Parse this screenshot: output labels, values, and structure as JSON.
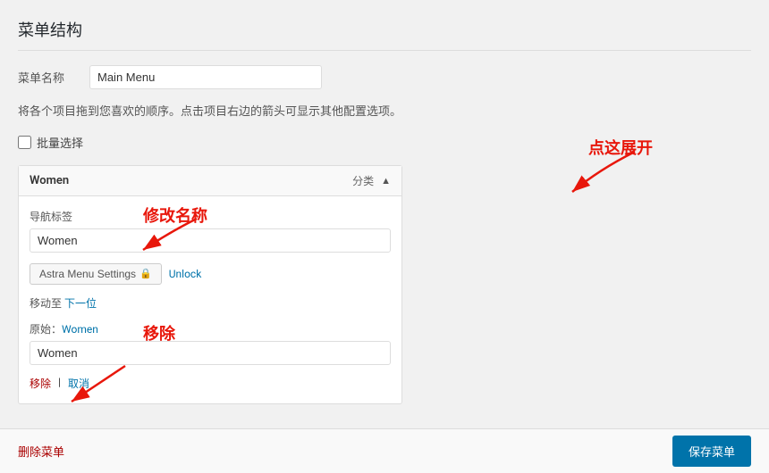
{
  "page": {
    "title": "菜单结构"
  },
  "form": {
    "menu_name_label": "菜单名称",
    "menu_name_value": "Main Menu",
    "menu_name_placeholder": "Main Menu"
  },
  "info": {
    "text": "将各个项目拖到您喜欢的顺序。点击项目右边的箭头可显示其他配置选项。"
  },
  "bulk_select": {
    "label": "批量选择"
  },
  "menu_item": {
    "title": "Women",
    "meta_category": "分类",
    "nav_label_field": "导航标签",
    "nav_label_value": "Women",
    "astra_btn_label": "Astra Menu Settings",
    "unlock_label": "Unlock",
    "move_label": "移动至",
    "move_next": "下一位",
    "move_prefix": "移动至",
    "original_label": "原始：",
    "original_link": "Women",
    "original_value": "Women",
    "remove_label": "移除",
    "cancel_label": "取消"
  },
  "annotations": {
    "expand_label": "点这展开",
    "rename_label": "修改名称",
    "move_remove_label": "移除"
  },
  "bottom": {
    "delete_label": "删除菜单",
    "save_label": "保存菜单"
  }
}
